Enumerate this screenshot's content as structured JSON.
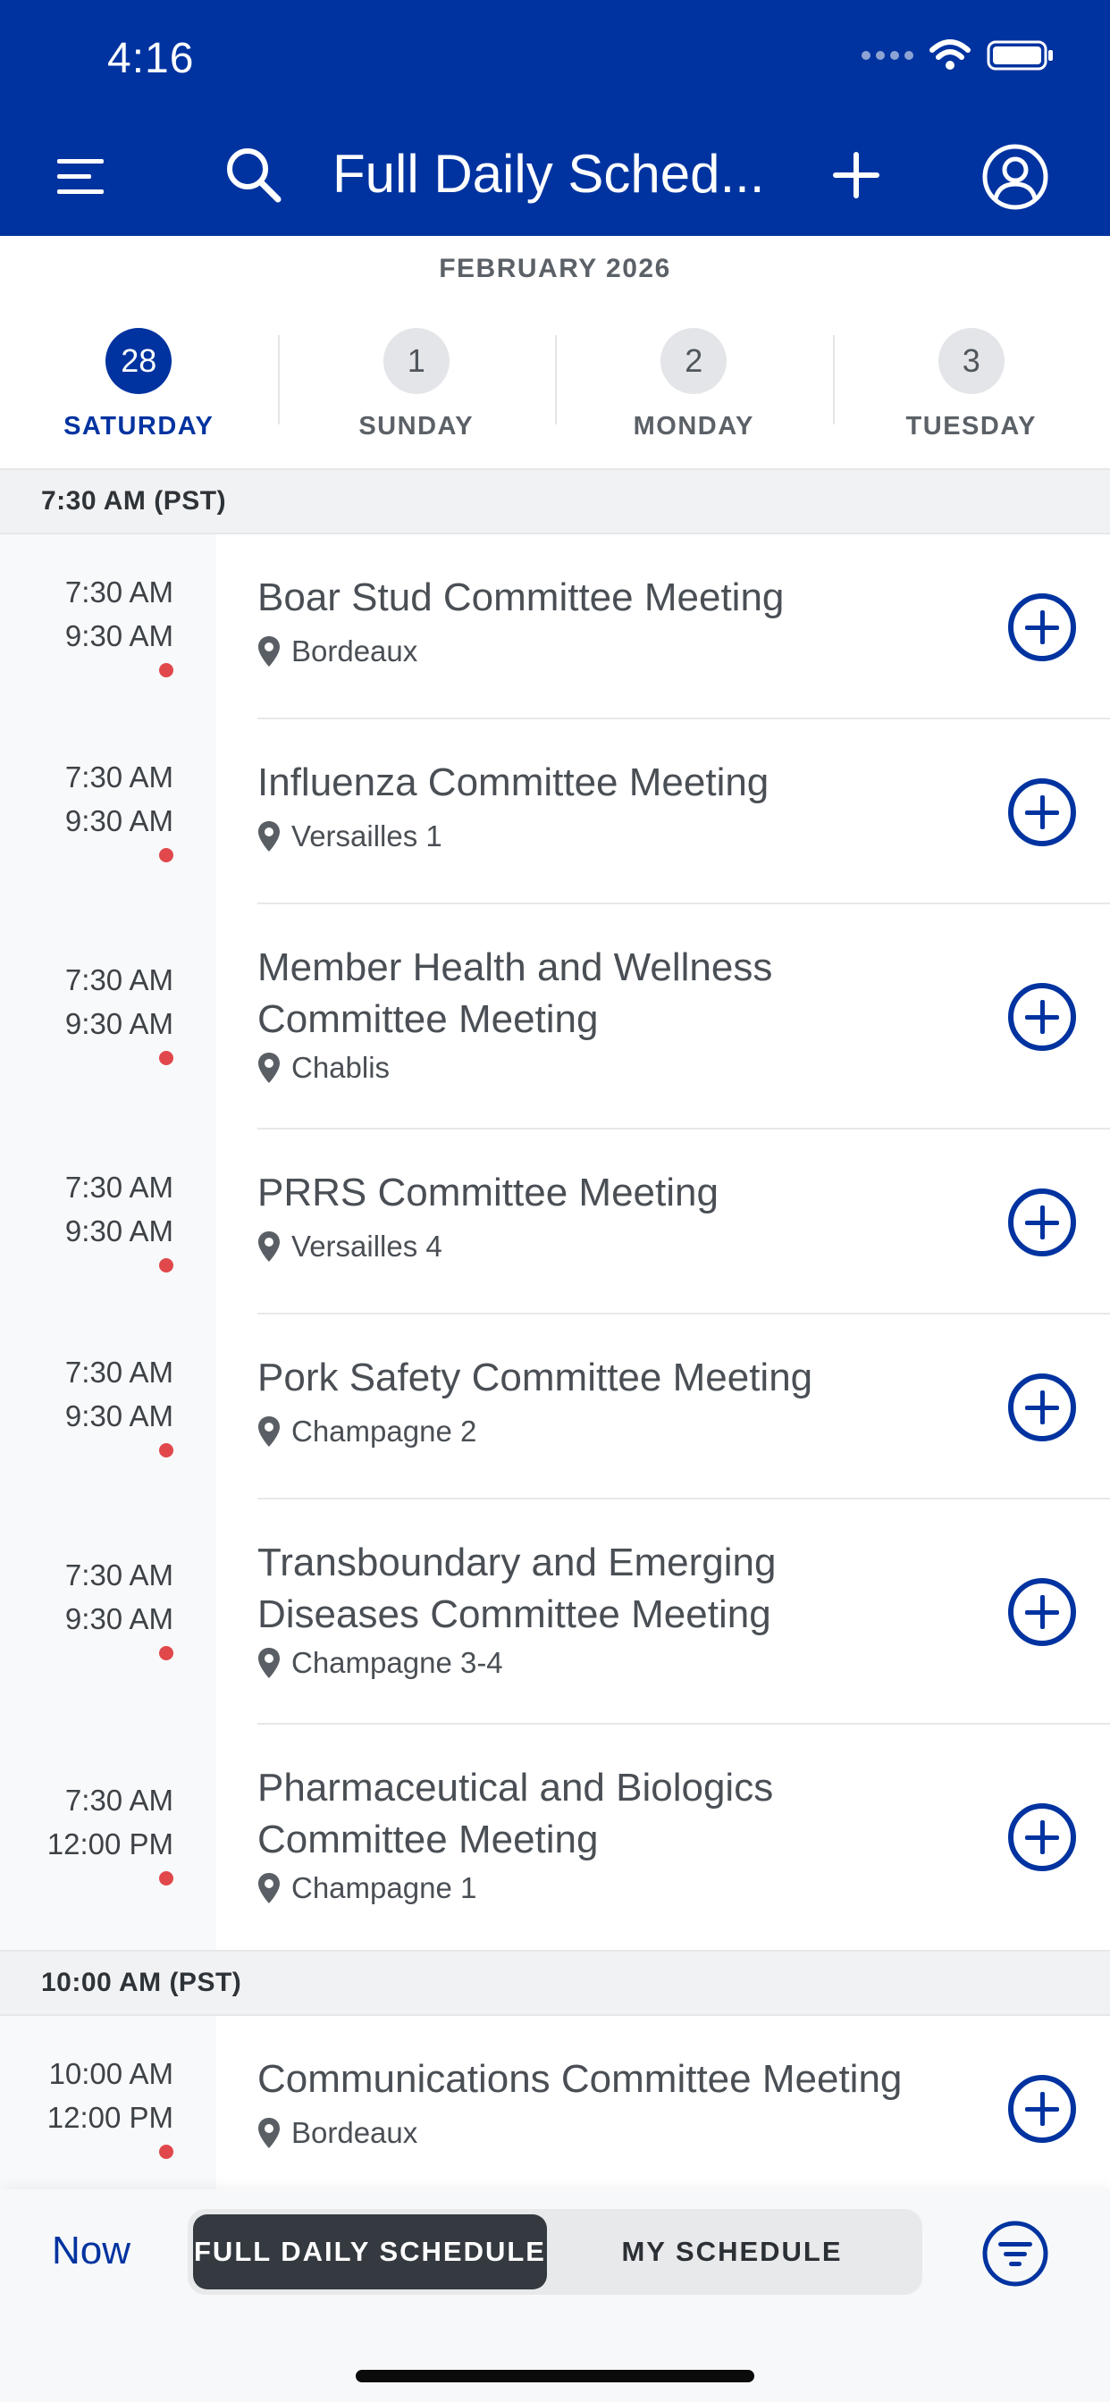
{
  "status_bar": {
    "time": "4:16"
  },
  "header": {
    "title": "Full Daily Sched..."
  },
  "calendar": {
    "month": "FEBRUARY 2026",
    "days": [
      {
        "num": "28",
        "name": "SATURDAY",
        "active": true
      },
      {
        "num": "1",
        "name": "SUNDAY",
        "active": false
      },
      {
        "num": "2",
        "name": "MONDAY",
        "active": false
      },
      {
        "num": "3",
        "name": "TUESDAY",
        "active": false
      }
    ]
  },
  "sections": [
    {
      "label": "7:30 AM (PST)"
    },
    {
      "label": "10:00 AM (PST)"
    }
  ],
  "events": [
    {
      "start": "7:30 AM",
      "end": "9:30 AM",
      "title": "Boar Stud Committee Meeting",
      "location": "Bordeaux"
    },
    {
      "start": "7:30 AM",
      "end": "9:30 AM",
      "title": "Influenza Committee Meeting",
      "location": "Versailles 1"
    },
    {
      "start": "7:30 AM",
      "end": "9:30 AM",
      "title": "Member Health and Wellness Committee Meeting",
      "location": "Chablis"
    },
    {
      "start": "7:30 AM",
      "end": "9:30 AM",
      "title": "PRRS Committee Meeting",
      "location": "Versailles 4"
    },
    {
      "start": "7:30 AM",
      "end": "9:30 AM",
      "title": "Pork Safety Committee Meeting",
      "location": "Champagne 2"
    },
    {
      "start": "7:30 AM",
      "end": "9:30 AM",
      "title": "Transboundary and Emerging Diseases Committee Meeting",
      "location": "Champagne 3-4"
    },
    {
      "start": "7:30 AM",
      "end": "12:00 PM",
      "title": "Pharmaceutical and Biologics Committee Meeting",
      "location": "Champagne 1"
    },
    {
      "start": "10:00 AM",
      "end": "12:00 PM",
      "title": "Communications Committee Meeting",
      "location": "Bordeaux"
    }
  ],
  "bottom_bar": {
    "now_label": "Now",
    "tab_full": "FULL DAILY SCHEDULE",
    "tab_mine": "MY SCHEDULE"
  },
  "colors": {
    "brand": "#0033a0",
    "dot": "#e0484c"
  }
}
